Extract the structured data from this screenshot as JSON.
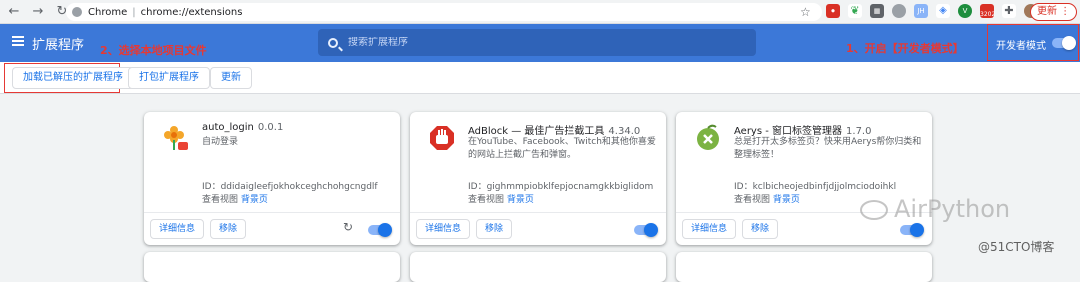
{
  "browser": {
    "site_name": "Chrome",
    "url": "chrome://extensions",
    "update_label": "更新",
    "badge_count": "3202"
  },
  "header": {
    "title": "扩展程序",
    "search_placeholder": "搜索扩展程序",
    "dev_mode_label": "开发者模式",
    "dev_mode_on": true
  },
  "annotations": {
    "step1": "1、开启【开发者模式】",
    "step2": "2、选择本地项目文件"
  },
  "toolbar": {
    "load_unpacked": "加载已解压的扩展程序",
    "pack": "打包扩展程序",
    "update": "更新"
  },
  "extensions": [
    {
      "name": "auto_login",
      "version": "0.0.1",
      "desc": "自动登录",
      "id_label": "ID：",
      "id": "ddidaigleefjokhokceghchohgcngdlf",
      "views_label": "查看视图",
      "views_link": "背景页",
      "details": "详细信息",
      "remove": "移除",
      "enabled": true
    },
    {
      "name": "AdBlock — 最佳广告拦截工具",
      "version": "4.34.0",
      "desc": "在YouTube、Facebook、Twitch和其他你喜爱的网站上拦截广告和弹窗。",
      "id_label": "ID：",
      "id": "gighmmpiobklfepjocnamgkkbiglidom",
      "views_label": "查看视图",
      "views_link": "背景页",
      "details": "详细信息",
      "remove": "移除",
      "enabled": true
    },
    {
      "name": "Aerys - 窗口标签管理器",
      "version": "1.7.0",
      "desc": "总是打开太多标签页？快来用Aerys帮你归类和整理标签！",
      "id_label": "ID：",
      "id": "kclbicheojedbinfjdjjolmciodoihkl",
      "views_label": "查看视图",
      "views_link": "背景页",
      "details": "详细信息",
      "remove": "移除",
      "enabled": true
    }
  ],
  "watermark": "AirPython",
  "blog_mark": "@51CTO博客",
  "colors": {
    "header_bg": "#3c78d8",
    "accent": "#1a73e8",
    "annotation": "#e53935"
  }
}
